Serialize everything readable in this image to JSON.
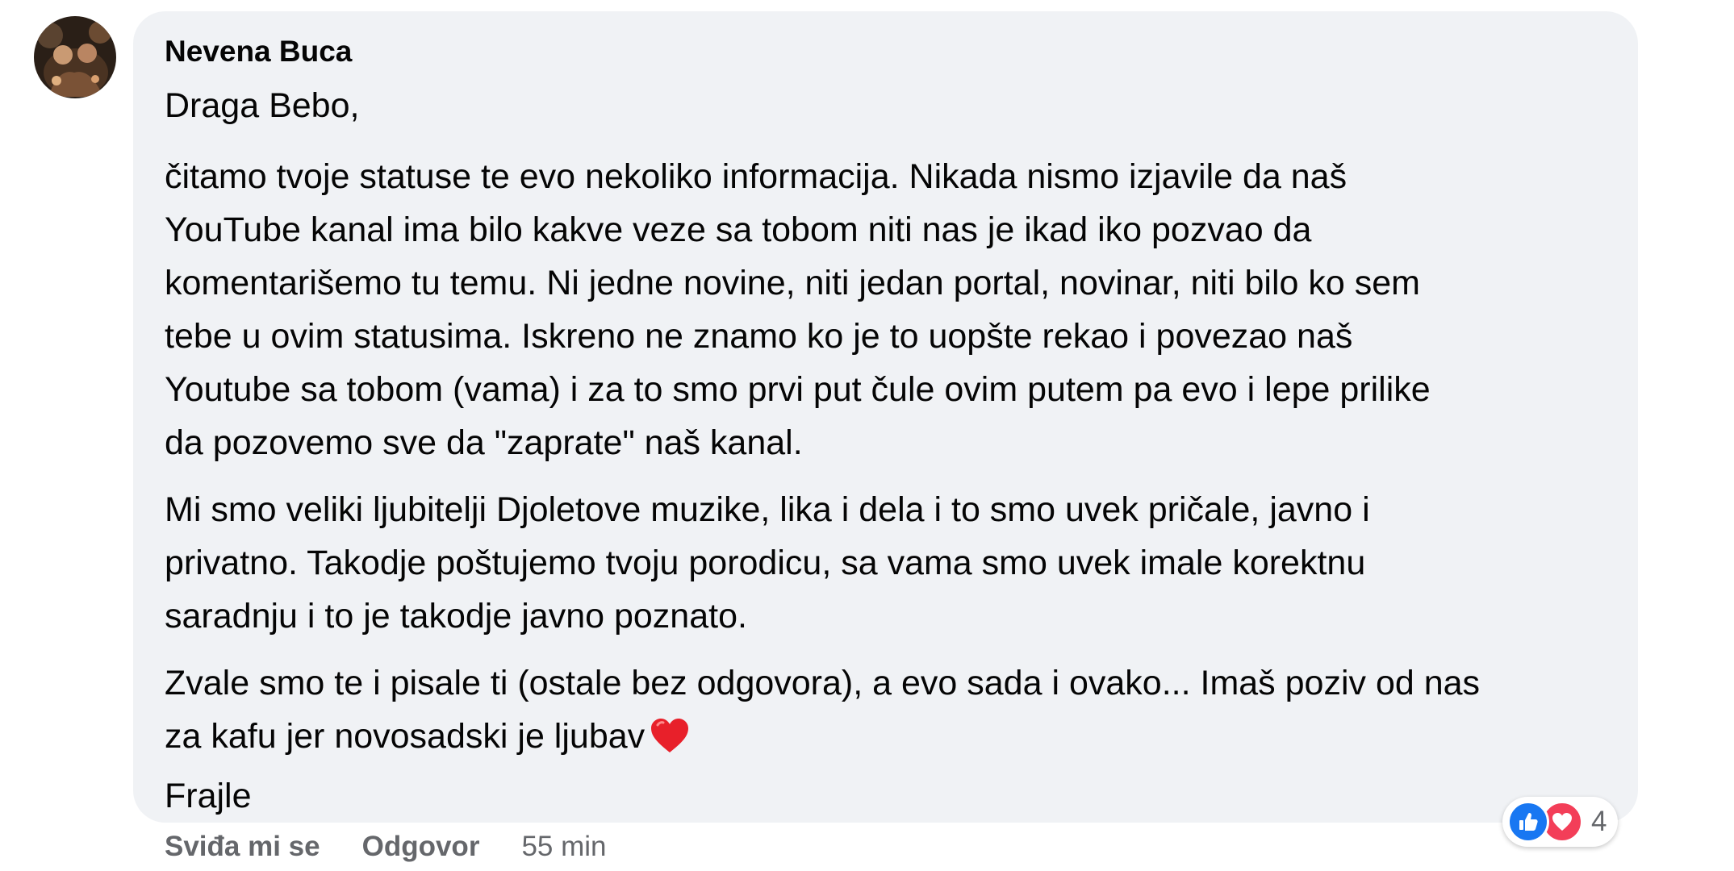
{
  "comment": {
    "author": "Nevena Buca",
    "paragraphs": [
      {
        "lines": [
          "Draga Bebo,"
        ]
      },
      {
        "lines": [
          "čitamo tvoje statuse te evo nekoliko informacija. Nikada nismo izjavile da naš",
          "YouTube kanal ima bilo kakve veze sa tobom niti nas je ikad iko pozvao da",
          "komentarišemo tu temu. Ni jedne novine, niti jedan portal, novinar, niti bilo ko sem",
          "tebe u ovim statusima. Iskreno ne znamo ko je to uopšte rekao i povezao naš",
          "Youtube sa tobom (vama) i za to smo prvi put čule ovim putem pa evo i lepe prilike",
          "da pozovemo sve da \"zaprate\" naš kanal."
        ]
      },
      {
        "lines": [
          "Mi smo veliki ljubitelji Djoletove muzike, lika i dela i to smo uvek pričale, javno i",
          "privatno. Takodje poštujemo tvoju porodicu, sa vama smo uvek imale korektnu",
          "saradnju i to je takodje javno poznato."
        ]
      },
      {
        "lines": [
          "Zvale smo te i pisale ti (ostale bez odgovora), a evo sada i ovako... Imaš poziv od nas",
          "za kafu jer novosadski je ljubav",
          "Frajle"
        ]
      }
    ],
    "emoji": "heart-emoji"
  },
  "actions": {
    "like_label": "Sviđa mi se",
    "reply_label": "Odgovor",
    "timestamp": "55 min"
  },
  "reactions": {
    "icons": [
      "like-reaction-icon",
      "love-reaction-icon"
    ],
    "count": "4",
    "colors": {
      "like": "#1877f2",
      "love": "#f33e58"
    }
  },
  "colors": {
    "bubble": "#f0f2f5",
    "text": "#050505",
    "secondary": "#65676b"
  }
}
